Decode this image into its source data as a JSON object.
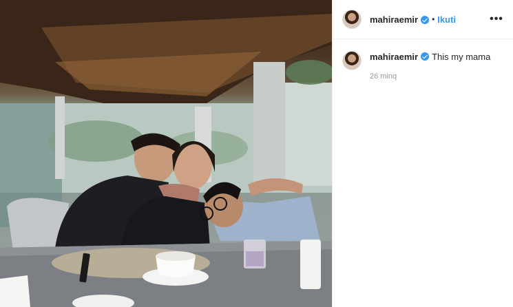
{
  "post": {
    "image_alt": "Family photo at a cafe",
    "header": {
      "username": "mahiraemir",
      "separator": "•",
      "follow_label": "Ikuti",
      "more_label": "•••",
      "verified_icon": "verified-badge-icon"
    },
    "caption": {
      "username": "mahiraemir",
      "text": "This my mama",
      "time": "26 minq"
    }
  },
  "colors": {
    "accent": "#3897f0",
    "text": "#262626",
    "muted": "#999999",
    "border": "#efefef"
  }
}
